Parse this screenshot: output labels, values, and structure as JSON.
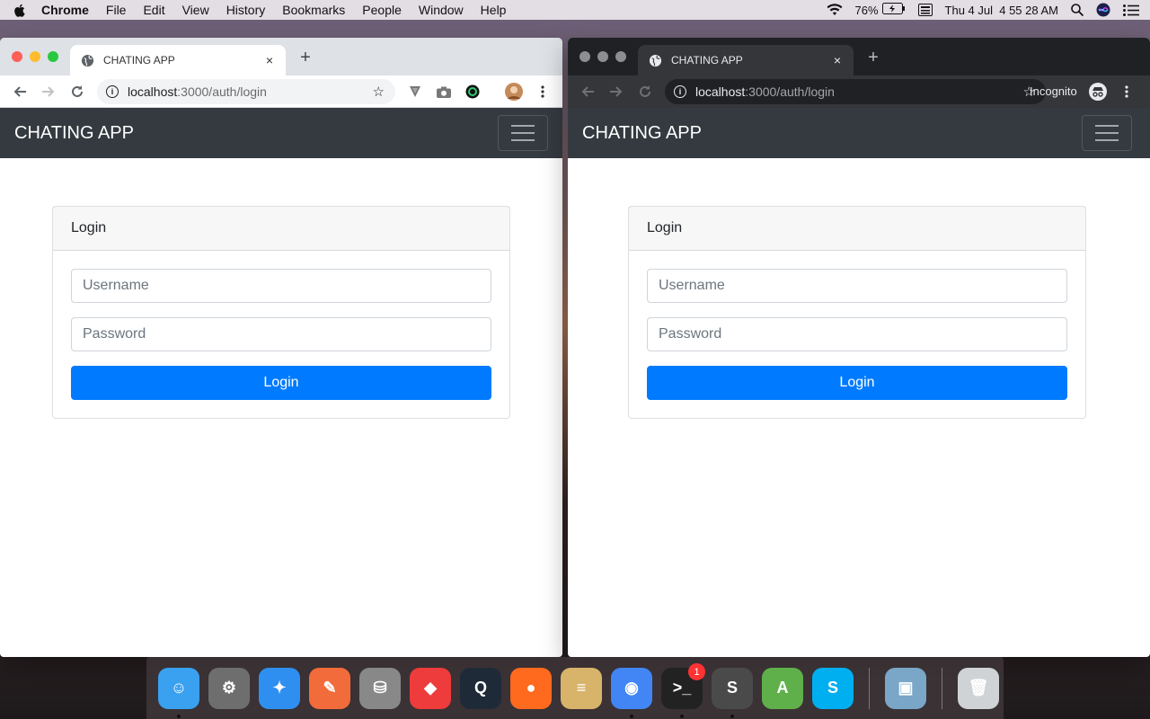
{
  "menubar": {
    "apple": "",
    "app": "Chrome",
    "items": [
      "File",
      "Edit",
      "View",
      "History",
      "Bookmarks",
      "People",
      "Window",
      "Help"
    ],
    "battery": "76%",
    "clock": "Thu 4 Jul  4 55 28 AM"
  },
  "browser": {
    "tab_title": "CHATING APP",
    "tab_close": "×",
    "new_tab": "+",
    "url_host": "localhost",
    "url_rest": ":3000/auth/login",
    "incognito_label": "Incognito"
  },
  "app": {
    "brand": "CHATING APP",
    "card_title": "Login",
    "username_placeholder": "Username",
    "password_placeholder": "Password",
    "login_label": "Login"
  },
  "dock": {
    "items": [
      {
        "name": "finder-icon",
        "color": "#3aa0f0",
        "glyph": "☺",
        "running": true
      },
      {
        "name": "system-preferences-icon",
        "color": "#6e6e6e",
        "glyph": "⚙",
        "running": false
      },
      {
        "name": "safari-icon",
        "color": "#2f8ff0",
        "glyph": "✦",
        "running": false
      },
      {
        "name": "postman-icon",
        "color": "#f26b3a",
        "glyph": "✎",
        "running": false
      },
      {
        "name": "disk-utility-icon",
        "color": "#888888",
        "glyph": "⛁",
        "running": false
      },
      {
        "name": "anydesk-icon",
        "color": "#ee3b3b",
        "glyph": "◆",
        "running": false
      },
      {
        "name": "quicktime-icon",
        "color": "#1f2a38",
        "glyph": "Q",
        "running": false
      },
      {
        "name": "firefox-icon",
        "color": "#ff6a1f",
        "glyph": "●",
        "running": false
      },
      {
        "name": "sequel-pro-icon",
        "color": "#d8b46a",
        "glyph": "≡",
        "running": false
      },
      {
        "name": "chrome-icon",
        "color": "#4285f4",
        "glyph": "◉",
        "running": true
      },
      {
        "name": "terminal-icon",
        "color": "#222222",
        "glyph": ">_",
        "running": true,
        "badge": "1"
      },
      {
        "name": "sublime-text-icon",
        "color": "#4a4a4a",
        "glyph": "S",
        "running": true
      },
      {
        "name": "android-studio-icon",
        "color": "#5fb04a",
        "glyph": "A",
        "running": false
      },
      {
        "name": "skype-icon",
        "color": "#00aff0",
        "glyph": "S",
        "running": false
      }
    ],
    "after_sep": [
      {
        "name": "preview-icon",
        "color": "#7aa6c8",
        "glyph": "▣",
        "running": false
      }
    ],
    "trash": {
      "name": "trash-icon",
      "color": "#cfd3d6",
      "glyph": "🗑",
      "running": false
    }
  }
}
